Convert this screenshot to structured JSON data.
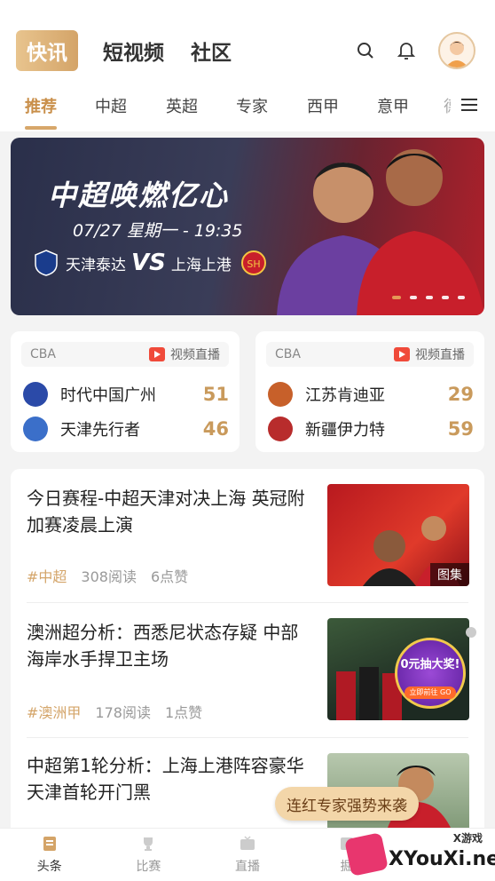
{
  "header": {
    "top_tabs": [
      "快讯",
      "短视频",
      "社区"
    ],
    "category_tabs": [
      "推荐",
      "中超",
      "英超",
      "专家",
      "西甲",
      "意甲",
      "德"
    ]
  },
  "banner": {
    "title": "中超唤燃亿心",
    "date_line": "07/27  星期一 - 19:35",
    "team_home": "天津泰达",
    "vs": "VS",
    "team_away": "上海上港",
    "slide_count": 5,
    "active_slide": 0
  },
  "score_cards": [
    {
      "league": "CBA",
      "live_label": "视频直播",
      "teams": [
        {
          "name": "时代中国广州",
          "score": "51",
          "color": "#2b4aa8"
        },
        {
          "name": "天津先行者",
          "score": "46",
          "color": "#3b6fc9"
        }
      ]
    },
    {
      "league": "CBA",
      "live_label": "视频直播",
      "teams": [
        {
          "name": "江苏肯迪亚",
          "score": "29",
          "color": "#c7602a"
        },
        {
          "name": "新疆伊力特",
          "score": "59",
          "color": "#b82c2c"
        }
      ]
    }
  ],
  "news": [
    {
      "title": "今日赛程-中超天津对决上海 英冠附加赛凌晨上演",
      "tag": "#中超",
      "reads": "308阅读",
      "likes": "6点赞",
      "badge": "图集"
    },
    {
      "title": "澳洲超分析：西悉尼状态存疑 中部海岸水手捍卫主场",
      "tag": "#澳洲甲",
      "reads": "178阅读",
      "likes": "1点赞",
      "ad_text": "0元抽大奖!",
      "ad_cta": "立即前往 GO"
    },
    {
      "title": "中超第1轮分析：上海上港阵容豪华 天津首轮开门黑"
    }
  ],
  "float_tag": "连红专家强势来袭",
  "bottom_nav": [
    "头条",
    "比赛",
    "直播",
    "掘"
  ],
  "watermark": {
    "small": "X游戏",
    "main": "XYouXi.net"
  },
  "colors": {
    "accent": "#d4a468",
    "score": "#c99a5c",
    "live_red": "#f04a3a"
  }
}
